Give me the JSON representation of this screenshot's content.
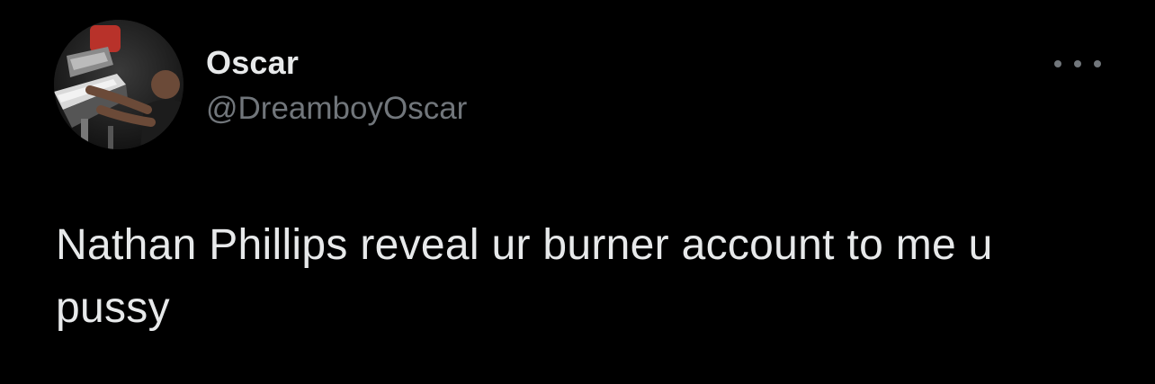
{
  "author": {
    "display_name": "Oscar",
    "handle": "@DreamboyOscar",
    "avatar_icon": "profile-photo"
  },
  "more_icon": "more-horizontal-icon",
  "tweet": {
    "text": "Nathan Phillips reveal ur burner account to me u pussy"
  },
  "colors": {
    "background": "#000000",
    "primary_text": "#e7e9ea",
    "secondary_text": "#71767b"
  }
}
